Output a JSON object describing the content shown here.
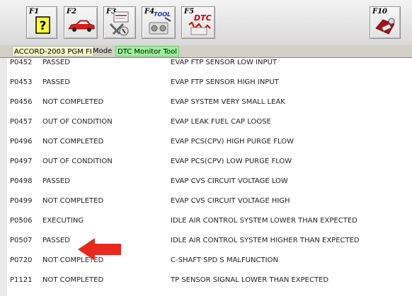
{
  "toolbar": {
    "keys": [
      {
        "label": "F1",
        "icon": "help-question-icon"
      },
      {
        "label": "F2",
        "icon": "red-car-icon"
      },
      {
        "label": "F3",
        "icon": "data-icon"
      },
      {
        "label": "F4",
        "icon": "tool-icon"
      },
      {
        "label": "F5",
        "icon": "dtc-icon",
        "icon_text": "DTC"
      },
      {
        "label": "F10",
        "icon": "exit-icon"
      }
    ],
    "tool_icon_text": "TOOL"
  },
  "status_bar": {
    "model": "ACCORD-2003",
    "system": "PGM FI",
    "mode_label": "Mode",
    "mode_value": "DTC Monitor Tool"
  },
  "rows": [
    {
      "code": "P0452",
      "status": "PASSED",
      "description": "EVAP FTP SENSOR LOW INPUT"
    },
    {
      "code": "P0453",
      "status": "PASSED",
      "description": "EVAP FTP SENSOR HIGH INPUT"
    },
    {
      "code": "P0456",
      "status": "NOT COMPLETED",
      "description": "EVAP SYSTEM VERY SMALL LEAK"
    },
    {
      "code": "P0457",
      "status": "OUT OF CONDITION",
      "description": "EVAP LEAK FUEL CAP LOOSE"
    },
    {
      "code": "P0496",
      "status": "NOT COMPLETED",
      "description": "EVAP PCS(CPV) HIGH PURGE FLOW"
    },
    {
      "code": "P0497",
      "status": "OUT OF CONDITION",
      "description": "EVAP PCS(CPV) LOW PURGE FLOW"
    },
    {
      "code": "P0498",
      "status": "PASSED",
      "description": "EVAP CVS CIRCUIT VOLTAGE LOW"
    },
    {
      "code": "P0499",
      "status": "NOT COMPLETED",
      "description": "EVAP CVS CIRCUIT VOLTAGE HIGH"
    },
    {
      "code": "P0506",
      "status": "EXECUTING",
      "description": "IDLE AIR CONTROL SYSTEM LOWER THAN EXPECTED"
    },
    {
      "code": "P0507",
      "status": "PASSED",
      "description": "IDLE AIR CONTROL SYSTEM HIGHER THAN EXPECTED"
    },
    {
      "code": "P0720",
      "status": "NOT COMPLETED",
      "description": "C-SHAFT SPD S MALFUNCTION"
    },
    {
      "code": "P1121",
      "status": "NOT COMPLETED",
      "description": "TP SENSOR SIGNAL LOWER THAN EXPECTED"
    }
  ],
  "colors": {
    "arrow": "#e8281e",
    "model_bg": "#f7f7c8",
    "mode_bg": "#9cf29c"
  }
}
